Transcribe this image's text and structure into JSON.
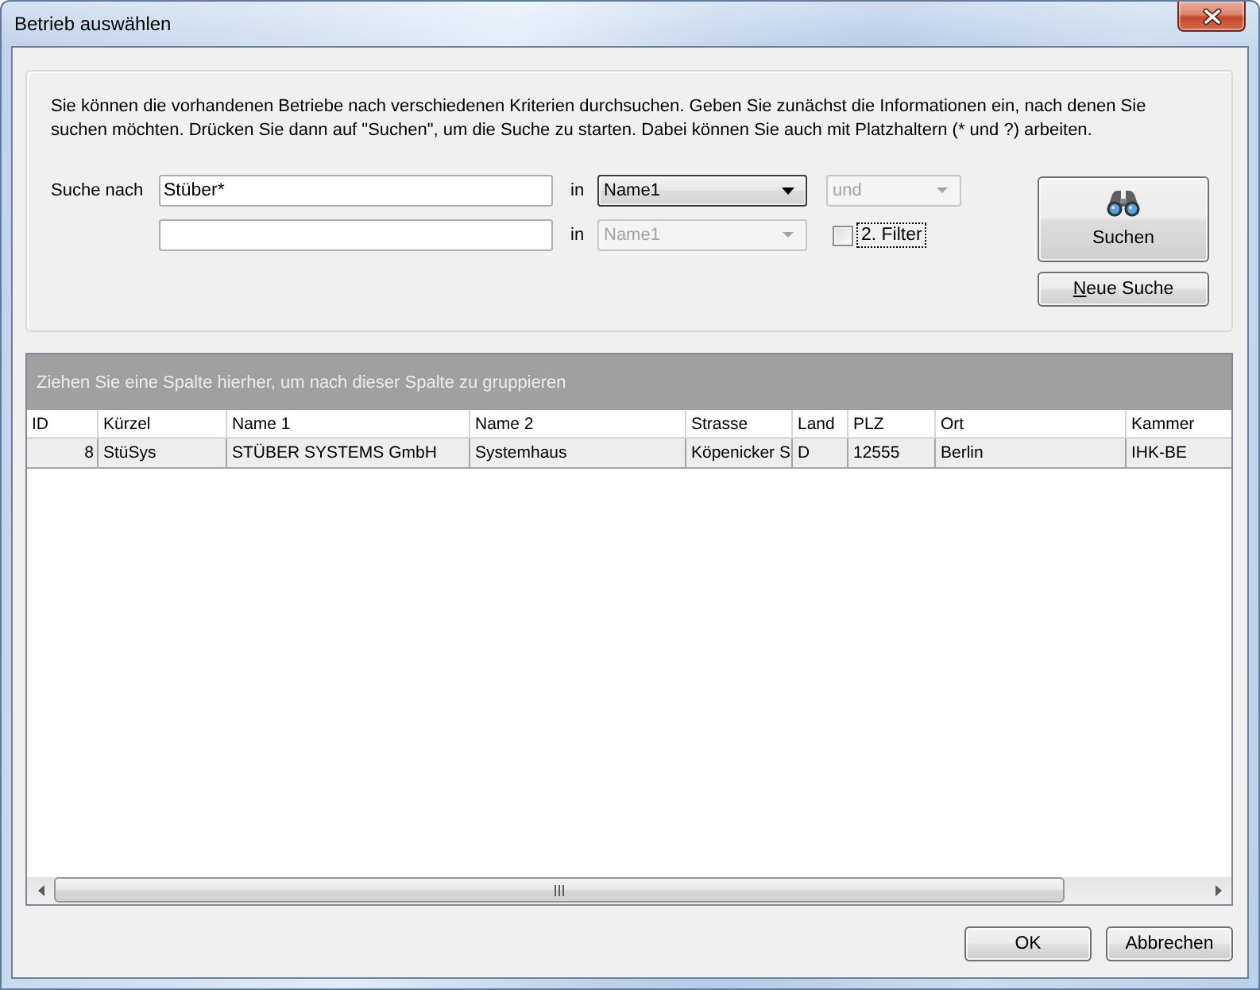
{
  "window": {
    "title": "Betrieb auswählen"
  },
  "search": {
    "description": "Sie können die vorhandenen Betriebe nach verschiedenen Kriterien durchsuchen. Geben Sie zunächst die Informationen ein, nach denen Sie suchen möchten. Drücken Sie dann auf \"Suchen\", um die Suche zu starten. Dabei können Sie auch mit Platzhaltern (* und ?) arbeiten.",
    "criteria": [
      {
        "label": "Suche nach",
        "value": "Stüber*",
        "in_label": "in",
        "field": {
          "value": "Name1",
          "disabled": false,
          "focused": true
        }
      },
      {
        "in_label": "in",
        "field": {
          "value": "Name1",
          "disabled": true,
          "focused": false
        }
      }
    ],
    "operator": {
      "value": "und",
      "disabled": true
    },
    "second_filter": {
      "label": "2. Filter",
      "checked": false,
      "focused": true
    },
    "buttons": [
      {
        "kind": "search",
        "label": "Suchen",
        "access_key": false
      },
      {
        "kind": "reset",
        "label": "Neue Suche",
        "access_key": true
      }
    ]
  },
  "grid": {
    "group_hint": "Ziehen Sie eine Spalte hierher, um nach dieser Spalte zu gruppieren",
    "columns": [
      {
        "label": "ID",
        "kind": "number"
      },
      {
        "label": "Kürzel",
        "kind": "text"
      },
      {
        "label": "Name 1",
        "kind": "text"
      },
      {
        "label": "Name 2",
        "kind": "text"
      },
      {
        "label": "Strasse",
        "kind": "text"
      },
      {
        "label": "Land",
        "kind": "text"
      },
      {
        "label": "PLZ",
        "kind": "text"
      },
      {
        "label": "Ort",
        "kind": "text"
      },
      {
        "label": "Kammer",
        "kind": "text"
      }
    ],
    "rows": [
      {
        "selected": true,
        "cells": [
          "8",
          "StüSys",
          "STÜBER SYSTEMS GmbH",
          "Systemhaus",
          "Köpenicker S",
          "D",
          "12555",
          "Berlin",
          "IHK-BE"
        ]
      }
    ]
  },
  "footer": {
    "buttons": [
      {
        "label": "OK"
      },
      {
        "label": "Abbrechen"
      }
    ]
  }
}
